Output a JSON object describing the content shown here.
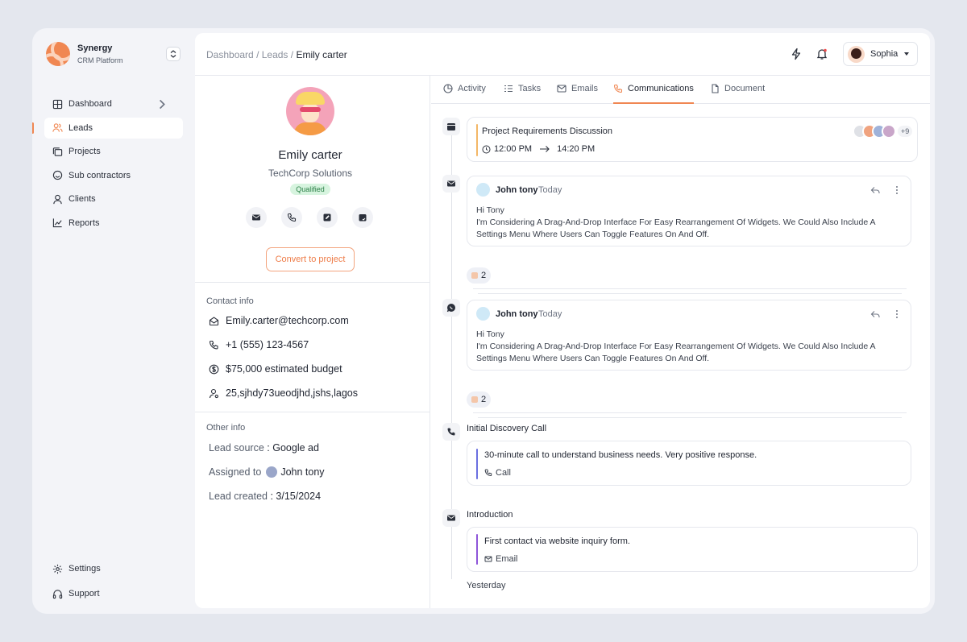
{
  "brand": {
    "name": "Synergy",
    "subtitle": "CRM Platform"
  },
  "sidebar": {
    "items": [
      {
        "label": "Dashboard",
        "icon": "grid-icon"
      },
      {
        "label": "Leads",
        "icon": "users-icon",
        "active": true
      },
      {
        "label": "Projects",
        "icon": "folders-icon"
      },
      {
        "label": "Sub contractors",
        "icon": "smile-icon"
      },
      {
        "label": "Clients",
        "icon": "user-icon"
      },
      {
        "label": "Reports",
        "icon": "chart-line-icon"
      }
    ],
    "bottom": [
      {
        "label": "Settings",
        "icon": "gear-icon"
      },
      {
        "label": "Support",
        "icon": "headset-icon"
      }
    ]
  },
  "header": {
    "breadcrumb": [
      "Dashboard",
      "Leads",
      "Emily carter"
    ],
    "separator": "/",
    "user": "Sophia"
  },
  "profile": {
    "name": "Emily carter",
    "company": "TechCorp Solutions",
    "status": "Qualified",
    "convert_label": "Convert to project",
    "contact_title": "Contact info",
    "email": "Emily.carter@techcorp.com",
    "phone": "+1 (555) 123-4567",
    "budget": "$75,000 estimated budget",
    "address": "25,sjhdy73ueodjhd,jshs,lagos",
    "other_title": "Other info",
    "lead_source_label": "Lead source",
    "lead_source": "Google ad",
    "assigned_label": "Assigned to",
    "assigned_to": "John tony",
    "created_label": "Lead created",
    "created": "3/15/2024"
  },
  "tabs": [
    {
      "label": "Activity",
      "icon": "pie-icon"
    },
    {
      "label": "Tasks",
      "icon": "list-icon"
    },
    {
      "label": "Emails",
      "icon": "mail-icon"
    },
    {
      "label": "Communications",
      "icon": "phone-icon",
      "active": true
    },
    {
      "label": "Document",
      "icon": "document-icon"
    }
  ],
  "timeline": {
    "meeting": {
      "title": "Project Requirements Discussion",
      "start": "12:00 PM",
      "end": "14:20 PM",
      "more": "+9"
    },
    "messages": [
      {
        "author": "John tony",
        "date": "Today",
        "greeting": "Hi Tony",
        "body": "I'm Considering A Drag-And-Drop Interface For Easy Rearrangement Of Widgets. We Could Also Include A Settings Menu Where Users Can Toggle Features On And Off.",
        "reactions": "2"
      },
      {
        "author": "John tony",
        "date": "Today",
        "greeting": "Hi Tony",
        "body": "I'm Considering A Drag-And-Drop Interface For Easy Rearrangement Of Widgets. We Could Also Include A Settings Menu Where Users Can Toggle Features On And Off.",
        "reactions": "2"
      }
    ],
    "call": {
      "label": "Initial Discovery Call",
      "text": "30-minute call to understand business needs. Very positive response.",
      "kind": "Call"
    },
    "intro": {
      "label": "Introduction",
      "text": "First contact via website inquiry form.",
      "kind": "Email"
    },
    "day_label": "Yesterday"
  },
  "colors": {
    "accent": "#f08752",
    "call_bar": "#6a6fe0",
    "email_bar": "#8e55d9",
    "meeting_bar": "#f3b766",
    "badge_bg": "#d7f4df"
  }
}
